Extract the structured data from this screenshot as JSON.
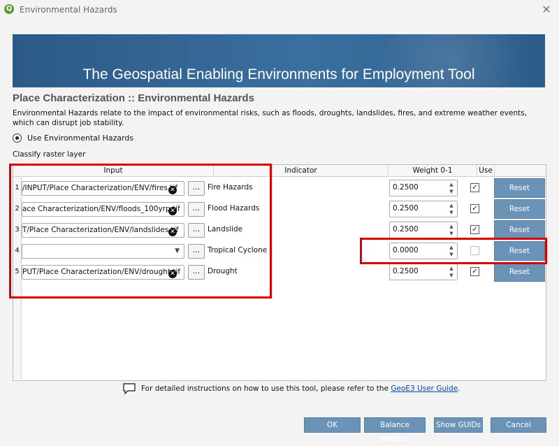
{
  "window": {
    "title": "Environmental Hazards",
    "app_icon": "Q"
  },
  "banner": {
    "title": "The Geospatial Enabling Environments for Employment Tool"
  },
  "section": {
    "title": "Place Characterization :: Environmental Hazards",
    "description": "Environmental Hazards relate to the impact of environmental risks, such as floods, droughts, landslides, fires, and extreme weather events, which can disrupt job stability.",
    "radio_label": "Use Environmental Hazards",
    "classify_label": "Classify raster layer"
  },
  "table": {
    "headers": [
      "Input",
      "Indicator",
      "Weight 0-1",
      "Use"
    ],
    "rows": [
      {
        "num": "1",
        "path": "/INPUT/Place Characterization/ENV/fires.tif",
        "browse": "...",
        "indicator": "Fire Hazards",
        "weight": "0.2500",
        "use": true,
        "reset": "Reset"
      },
      {
        "num": "2",
        "path": "ace Characterization/ENV/floods_100yrp.tif",
        "browse": "...",
        "indicator": "Flood Hazards",
        "weight": "0.2500",
        "use": true,
        "reset": "Reset"
      },
      {
        "num": "3",
        "path": "T/Place Characterization/ENV/landslides.tif",
        "browse": "...",
        "indicator": "Landslide",
        "weight": "0.2500",
        "use": true,
        "reset": "Reset"
      },
      {
        "num": "4",
        "path": "",
        "browse": "...",
        "indicator": "Tropical Cyclone",
        "weight": "0.0000",
        "use": false,
        "reset": "Reset"
      },
      {
        "num": "5",
        "path": "PUT/Place Characterization/ENV/drought.tif",
        "browse": "...",
        "indicator": "Drought",
        "weight": "0.2500",
        "use": true,
        "reset": "Reset"
      }
    ]
  },
  "help": {
    "text": "For detailed instructions on how to use this tool, please refer to the ",
    "link": "GeoE3 User Guide",
    "suffix": "."
  },
  "buttons": {
    "ok": "OK",
    "balance": "Balance Weights",
    "guids": "Show GUIDs",
    "cancel": "Cancel"
  },
  "colors": {
    "accent": "#6b93b8",
    "highlight": "#d40000",
    "banner": "#2b5a86"
  }
}
